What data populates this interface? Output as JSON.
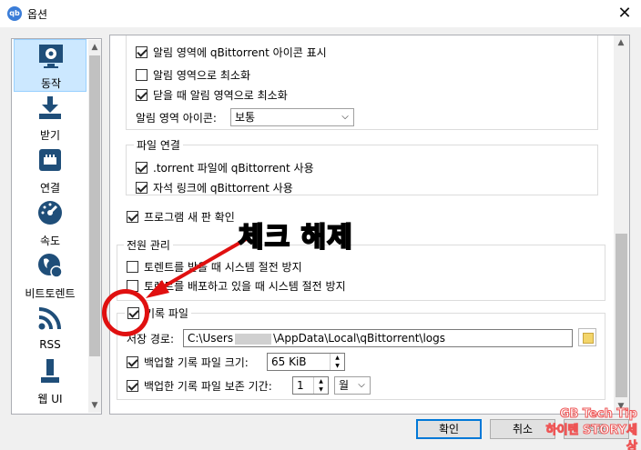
{
  "window": {
    "title": "옵션",
    "icon_text": "qb",
    "close": "✕"
  },
  "sidebar": {
    "items": [
      {
        "label": "동작",
        "icon": "gear-monitor-icon"
      },
      {
        "label": "받기",
        "icon": "download-icon"
      },
      {
        "label": "연결",
        "icon": "network-icon"
      },
      {
        "label": "속도",
        "icon": "speedometer-icon"
      },
      {
        "label": "비트토렌트",
        "icon": "globe-icon"
      },
      {
        "label": "RSS",
        "icon": "rss-icon"
      },
      {
        "label": "웹 UI",
        "icon": "webui-icon"
      }
    ]
  },
  "tray": {
    "show_icon": "알림 영역에 qBittorrent 아이콘 표시",
    "minimize": "알림 영역으로 최소화",
    "close_minimize": "닫을 때 알림 영역으로 최소화",
    "icon_label": "알림 영역 아이콘:",
    "icon_value": "보통"
  },
  "file_assoc": {
    "title": "파일 연결",
    "torrent": ".torrent 파일에 qBittorrent  사용",
    "magnet": "자석 링크에 qBittorrent 사용"
  },
  "check_update": "프로그램 새 판 확인",
  "power": {
    "title": "전원 관리",
    "inhibit_download": "토렌트를 받을 때 시스템 절전 방지",
    "inhibit_seed": "토렌트를 배포하고 있을 때 시스템 절전 방지"
  },
  "log": {
    "title": "기록 파일",
    "path_label": "저장 경로:",
    "path_prefix": "C:\\Users",
    "path_suffix": "\\AppData\\Local\\qBittorrent\\logs",
    "backup_label": "백업할 기록 파일 크기:",
    "backup_value": "65 KiB",
    "delete_label": "백업한 기록 파일 보존 기간:",
    "delete_value": "1",
    "delete_unit": "월"
  },
  "buttons": {
    "ok": "확인",
    "cancel": "취소",
    "apply": "적용"
  },
  "annotation": {
    "text": "체크 해제",
    "color": "#e01010"
  },
  "watermark": {
    "line1": "GB Tech Tip",
    "line2": "하이텐 STORY세상"
  }
}
